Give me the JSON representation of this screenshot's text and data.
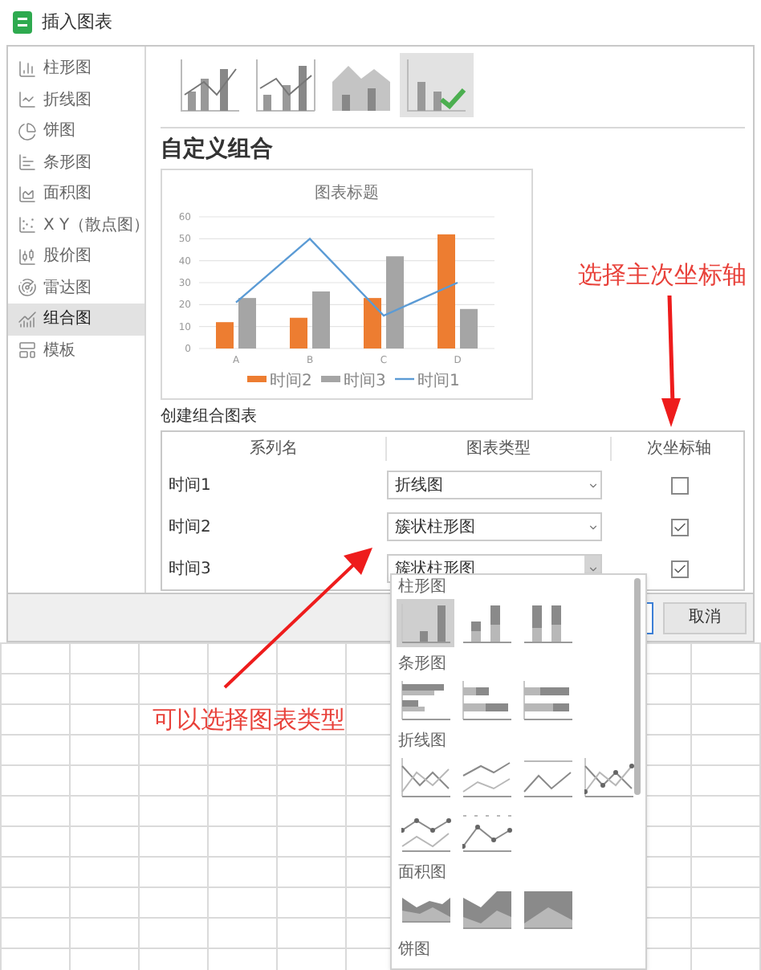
{
  "window": {
    "title": "插入图表"
  },
  "sidebar": {
    "items": [
      {
        "label": "柱形图",
        "kind": "column",
        "selected": false
      },
      {
        "label": "折线图",
        "kind": "line",
        "selected": false
      },
      {
        "label": "饼图",
        "kind": "pie",
        "selected": false
      },
      {
        "label": "条形图",
        "kind": "bar",
        "selected": false
      },
      {
        "label": "面积图",
        "kind": "area",
        "selected": false
      },
      {
        "label": "X Y（散点图）",
        "kind": "scatter",
        "selected": false
      },
      {
        "label": "股价图",
        "kind": "stock",
        "selected": false
      },
      {
        "label": "雷达图",
        "kind": "radar",
        "selected": false
      },
      {
        "label": "组合图",
        "kind": "combo",
        "selected": true
      },
      {
        "label": "模板",
        "kind": "template",
        "selected": false
      }
    ]
  },
  "subtypes": [
    {
      "kind": "column-line",
      "selected": false
    },
    {
      "kind": "column-line-secondary",
      "selected": false
    },
    {
      "kind": "area-column",
      "selected": false
    },
    {
      "kind": "custom",
      "selected": true
    }
  ],
  "heading": "自定义组合",
  "preview": {
    "chart_data": {
      "type": "bar",
      "title": "图表标题",
      "categories": [
        "A",
        "B",
        "C",
        "D"
      ],
      "yticks": [
        0,
        10,
        20,
        30,
        40,
        50,
        60
      ],
      "ylim": [
        0,
        60
      ],
      "stacked": false,
      "grid": true,
      "legend": "bottom",
      "series": [
        {
          "name": "时间2",
          "type": "bar",
          "color": "#ed7d31",
          "values": [
            12,
            14,
            23,
            52
          ]
        },
        {
          "name": "时间3",
          "type": "bar",
          "color": "#a5a5a5",
          "values": [
            23,
            26,
            42,
            18
          ]
        },
        {
          "name": "时间1",
          "type": "line",
          "color": "#5b9bd5",
          "values": [
            21,
            50,
            15,
            30
          ]
        }
      ]
    }
  },
  "combo": {
    "title": "创建组合图表",
    "columns": [
      "系列名",
      "图表类型",
      "次坐标轴"
    ],
    "rows": [
      {
        "series": "时间1",
        "type": "折线图",
        "secondary_axis": false,
        "open": false
      },
      {
        "series": "时间2",
        "type": "簇状柱形图",
        "secondary_axis": true,
        "open": false
      },
      {
        "series": "时间3",
        "type": "簇状柱形图",
        "secondary_axis": true,
        "open": true
      }
    ]
  },
  "dialog_buttons": [
    {
      "label": "取消"
    }
  ],
  "dropdown": {
    "sections": [
      {
        "title": "柱形图",
        "options": [
          {
            "kind": "clustered-column",
            "selected": true
          },
          {
            "kind": "stacked-column",
            "selected": false
          },
          {
            "kind": "percent-column",
            "selected": false
          }
        ]
      },
      {
        "title": "条形图",
        "options": [
          {
            "kind": "clustered-bar",
            "selected": false
          },
          {
            "kind": "stacked-bar",
            "selected": false
          },
          {
            "kind": "percent-bar",
            "selected": false
          }
        ]
      },
      {
        "title": "折线图",
        "options": [
          {
            "kind": "line",
            "selected": false
          },
          {
            "kind": "stacked-line",
            "selected": false
          },
          {
            "kind": "percent-line",
            "selected": false
          },
          {
            "kind": "marker-line",
            "selected": false
          },
          {
            "kind": "stacked-marker-line",
            "selected": false
          },
          {
            "kind": "percent-marker-line",
            "selected": false
          }
        ]
      },
      {
        "title": "面积图",
        "options": [
          {
            "kind": "area",
            "selected": false
          },
          {
            "kind": "stacked-area",
            "selected": false
          },
          {
            "kind": "percent-area",
            "selected": false
          }
        ]
      },
      {
        "title": "饼图"
      }
    ]
  },
  "annotations": [
    {
      "text": "选择主次坐标轴"
    },
    {
      "text": "可以选择图表类型"
    }
  ]
}
